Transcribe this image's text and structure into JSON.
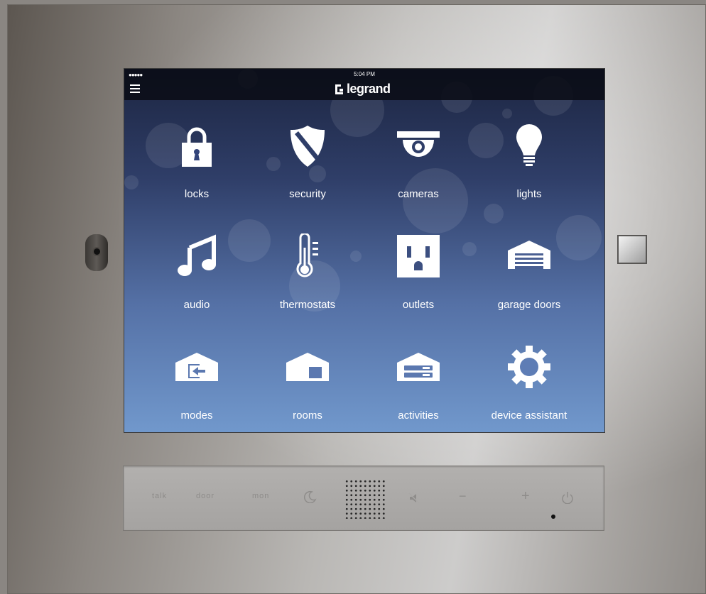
{
  "status_bar": {
    "signal": "●●●●●",
    "time": "5:04 PM"
  },
  "header": {
    "brand": "legrand"
  },
  "tiles": [
    {
      "label": "locks",
      "icon": "lock-icon"
    },
    {
      "label": "security",
      "icon": "shield-icon"
    },
    {
      "label": "cameras",
      "icon": "camera-icon"
    },
    {
      "label": "lights",
      "icon": "lightbulb-icon"
    },
    {
      "label": "audio",
      "icon": "music-note-icon"
    },
    {
      "label": "thermostats",
      "icon": "thermometer-icon"
    },
    {
      "label": "outlets",
      "icon": "outlet-icon"
    },
    {
      "label": "garage doors",
      "icon": "garage-icon"
    },
    {
      "label": "modes",
      "icon": "home-enter-icon"
    },
    {
      "label": "rooms",
      "icon": "house-icon"
    },
    {
      "label": "activities",
      "icon": "house-list-icon"
    },
    {
      "label": "device assistant",
      "icon": "gear-icon"
    }
  ],
  "panel_buttons": {
    "talk": "talk",
    "door": "door",
    "mon": "mon",
    "minus": "−",
    "plus": "+"
  },
  "colors": {
    "screen_top": "#1c2541",
    "screen_bottom": "#7198cc",
    "icon": "#ffffff"
  }
}
